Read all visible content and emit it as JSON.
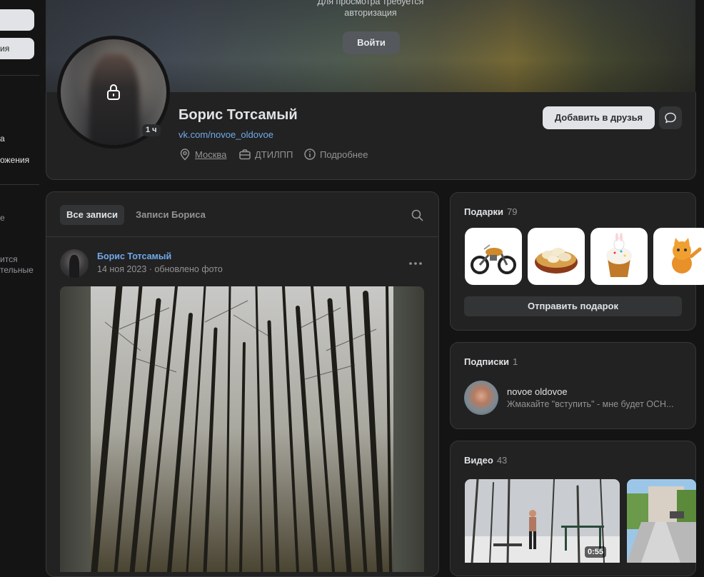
{
  "sidebar": {
    "button1_label": "",
    "button2_label": "ия",
    "item_a": "а",
    "item_b": "ожения",
    "item_c": "е",
    "item_d": "ится",
    "item_e": "тельные"
  },
  "cover": {
    "auth_text_line1": "Для просмотра требуется",
    "auth_text_line2": "авторизация",
    "login_label": "Войти"
  },
  "profile": {
    "name": "Борис Тотсамый",
    "link": "vk.com/novoe_oldovoe",
    "last_seen_badge": "1 ч",
    "city": "Москва",
    "work": "ДТИЛПП",
    "more": "Подробнее",
    "add_friend_label": "Добавить в друзья"
  },
  "wall": {
    "tab_all": "Все записи",
    "tab_owner": "Записи Бориса",
    "post": {
      "author": "Борис Тотсамый",
      "date": "14 ноя 2023",
      "separator": "·",
      "action": "обновлено фото"
    }
  },
  "gifts": {
    "title": "Подарки",
    "count": "79",
    "items": [
      "motorcycle-gift",
      "dumplings-gift",
      "easter-cake-gift",
      "cat-gift"
    ],
    "send_label": "Отправить подарок"
  },
  "subscriptions": {
    "title": "Подписки",
    "count": "1",
    "item": {
      "name": "novoe oldovoe",
      "description": "Жмакайте \"вступить\" - мне будет ОСН..."
    }
  },
  "videos": {
    "title": "Видео",
    "count": "43",
    "first_duration": "0:55"
  },
  "colors": {
    "background": "#141414",
    "card": "#222222",
    "link": "#71aaeb",
    "secondary_text": "#939393"
  }
}
